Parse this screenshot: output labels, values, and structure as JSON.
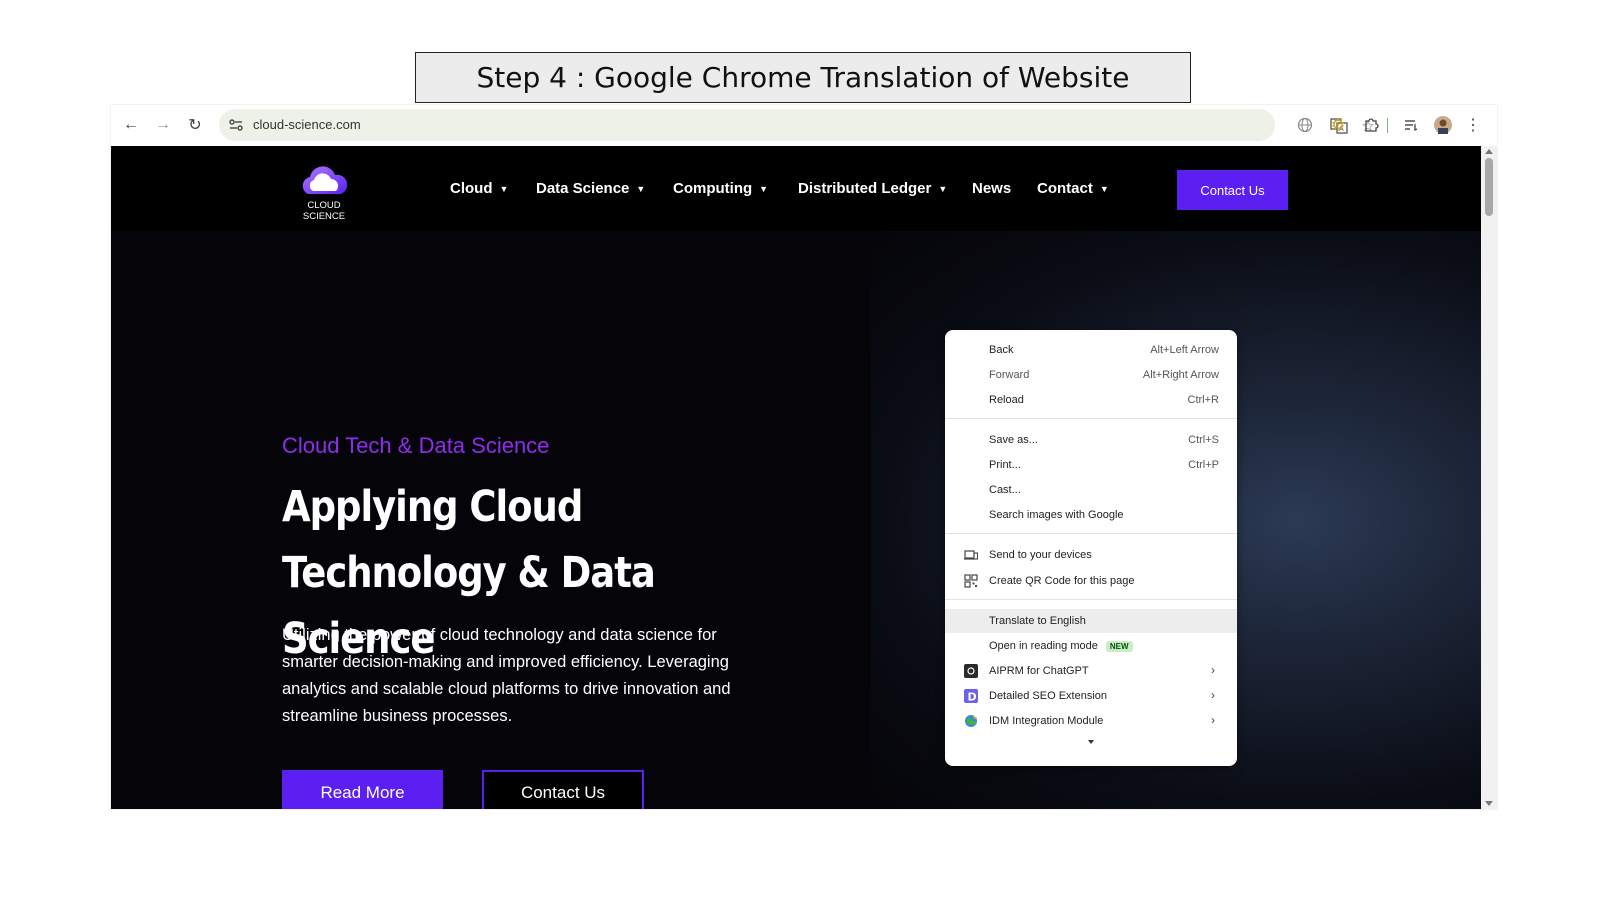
{
  "caption": "Step 4 : Google Chrome Translation of Website",
  "browser": {
    "url": "cloud-science.com",
    "toolbar_icons": [
      "back-arrow-icon",
      "forward-arrow-icon",
      "reload-icon",
      "site-settings-icon",
      "translate-icon",
      "bookmark-star-icon",
      "extension-globe-icon",
      "extension-gear-icon",
      "extensions-puzzle-icon",
      "reading-list-icon",
      "profile-avatar-icon",
      "more-menu-icon"
    ]
  },
  "site": {
    "logo_text": "CLOUD SCIENCE",
    "nav": [
      {
        "label": "Cloud",
        "dropdown": true
      },
      {
        "label": "Data Science",
        "dropdown": true
      },
      {
        "label": "Computing",
        "dropdown": true
      },
      {
        "label": "Distributed Ledger",
        "dropdown": true
      },
      {
        "label": "News",
        "dropdown": false
      },
      {
        "label": "Contact",
        "dropdown": true
      }
    ],
    "nav_cta": "Contact Us",
    "hero": {
      "kicker": "Cloud Tech & Data Science",
      "headline": "Applying Cloud Technology & Data Science",
      "body": "Utilizing the power of cloud technology and data science for smarter decision-making and improved efficiency. Leveraging analytics and scalable cloud platforms to drive innovation and streamline business processes.",
      "primary_button": "Read More",
      "secondary_button": "Contact Us"
    },
    "colors": {
      "accent": "#5b1ff2",
      "kicker": "#8f2cf0",
      "background": "#050509"
    }
  },
  "context_menu": {
    "items": [
      {
        "label": "Back",
        "shortcut": "Alt+Left Arrow"
      },
      {
        "label": "Forward",
        "shortcut": "Alt+Right Arrow"
      },
      {
        "label": "Reload",
        "shortcut": "Ctrl+R"
      },
      {
        "label": "Save as...",
        "shortcut": "Ctrl+S"
      },
      {
        "label": "Print...",
        "shortcut": "Ctrl+P"
      },
      {
        "label": "Cast..."
      },
      {
        "label": "Search images with Google"
      },
      {
        "label": "Send to your devices",
        "icon": "devices-icon"
      },
      {
        "label": "Create QR Code for this page",
        "icon": "qr-code-icon"
      },
      {
        "label": "Translate to English",
        "highlighted": true
      },
      {
        "label": "Open in reading mode",
        "badge": "NEW"
      },
      {
        "label": "AIPRM for ChatGPT",
        "icon": "aiprm-icon",
        "submenu": true
      },
      {
        "label": "Detailed SEO Extension",
        "icon": "seo-d-icon",
        "submenu": true
      },
      {
        "label": "IDM Integration Module",
        "icon": "idm-globe-icon",
        "submenu": true
      }
    ]
  }
}
